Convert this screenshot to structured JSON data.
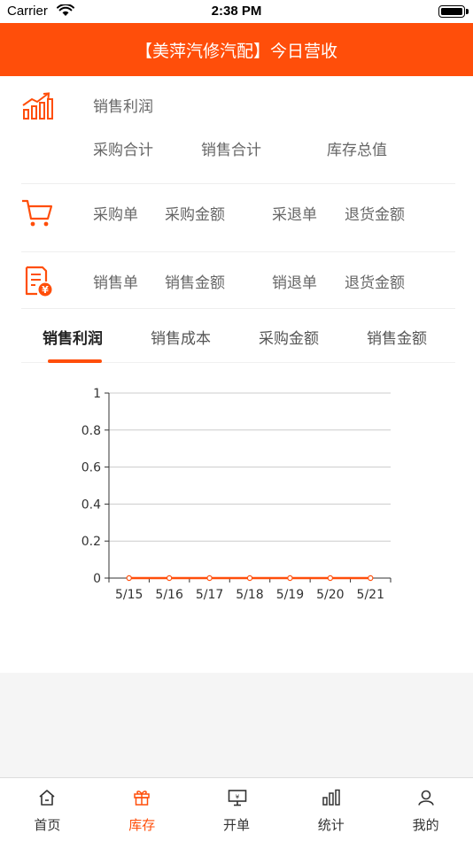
{
  "status_bar": {
    "carrier": "Carrier",
    "time": "2:38 PM"
  },
  "header": {
    "title": "【美萍汽修汽配】今日营收"
  },
  "profit_section": {
    "label": "销售利润",
    "sub_labels": [
      "采购合计",
      "销售合计",
      "库存总值"
    ]
  },
  "purchase_section": {
    "labels": [
      "采购单",
      "采购金额",
      "采退单",
      "退货金额"
    ]
  },
  "sales_section": {
    "labels": [
      "销售单",
      "销售金额",
      "销退单",
      "退货金额"
    ]
  },
  "tabs": [
    {
      "label": "销售利润",
      "active": true
    },
    {
      "label": "销售成本",
      "active": false
    },
    {
      "label": "采购金额",
      "active": false
    },
    {
      "label": "销售金额",
      "active": false
    }
  ],
  "chart_data": {
    "type": "line",
    "categories": [
      "5/15",
      "5/16",
      "5/17",
      "5/18",
      "5/19",
      "5/20",
      "5/21"
    ],
    "series": [
      {
        "values": [
          0,
          0,
          0,
          0,
          0,
          0,
          0
        ]
      }
    ],
    "y_ticks": [
      "0",
      "0.2",
      "0.4",
      "0.6",
      "0.8",
      "1"
    ],
    "ylim": [
      0,
      1
    ],
    "grid": true,
    "line_color": "#ff4e0a"
  },
  "tabbar": {
    "items": [
      {
        "label": "首页",
        "icon": "home-icon"
      },
      {
        "label": "库存",
        "icon": "gift-icon"
      },
      {
        "label": "开单",
        "icon": "monitor-icon"
      },
      {
        "label": "统计",
        "icon": "bar-chart-icon"
      },
      {
        "label": "我的",
        "icon": "user-icon"
      }
    ],
    "active_index": 1
  },
  "colors": {
    "accent": "#ff4e0a"
  }
}
